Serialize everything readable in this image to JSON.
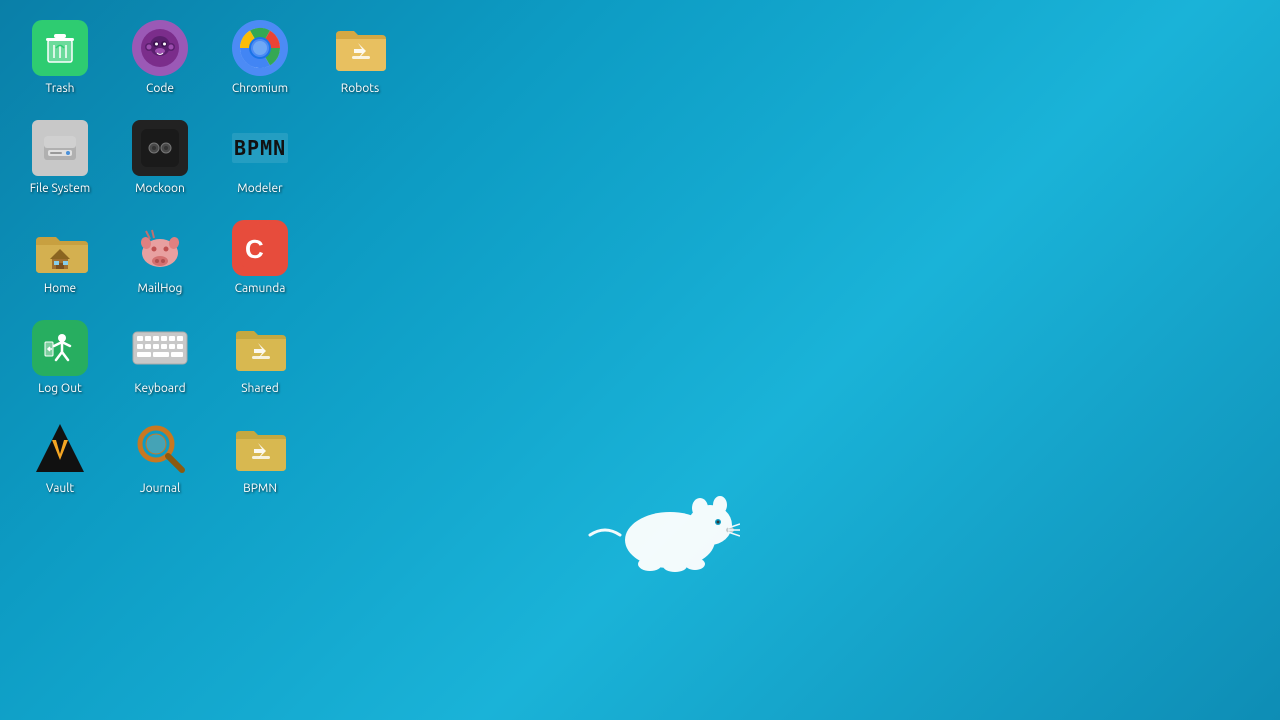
{
  "desktop": {
    "background": "teal-blue gradient",
    "mascot": "white mouse"
  },
  "icons": [
    {
      "id": "trash",
      "label": "Trash",
      "type": "trash",
      "row": 1,
      "col": 1
    },
    {
      "id": "code",
      "label": "Code",
      "type": "code",
      "row": 1,
      "col": 2
    },
    {
      "id": "chromium",
      "label": "Chromium",
      "type": "chromium",
      "row": 1,
      "col": 3
    },
    {
      "id": "robots",
      "label": "Robots",
      "type": "folder-shared",
      "row": 1,
      "col": 4
    },
    {
      "id": "filesystem",
      "label": "File System",
      "type": "filesystem",
      "row": 2,
      "col": 1
    },
    {
      "id": "mockoon",
      "label": "Mockoon",
      "type": "mockoon",
      "row": 2,
      "col": 2
    },
    {
      "id": "modeler",
      "label": "Modeler",
      "type": "modeler",
      "row": 2,
      "col": 3
    },
    {
      "id": "home",
      "label": "Home",
      "type": "home",
      "row": 3,
      "col": 1
    },
    {
      "id": "mailhog",
      "label": "MailHog",
      "type": "mailhog",
      "row": 3,
      "col": 2
    },
    {
      "id": "camunda",
      "label": "Camunda",
      "type": "camunda",
      "row": 3,
      "col": 3
    },
    {
      "id": "logout",
      "label": "Log Out",
      "type": "logout",
      "row": 4,
      "col": 1
    },
    {
      "id": "keyboard",
      "label": "Keyboard",
      "type": "keyboard",
      "row": 4,
      "col": 2
    },
    {
      "id": "shared",
      "label": "Shared",
      "type": "folder-shared",
      "row": 4,
      "col": 3
    },
    {
      "id": "vault",
      "label": "Vault",
      "type": "vault",
      "row": 5,
      "col": 1
    },
    {
      "id": "journal",
      "label": "Journal",
      "type": "journal",
      "row": 5,
      "col": 2
    },
    {
      "id": "bpmn",
      "label": "BPMN",
      "type": "folder-shared",
      "row": 5,
      "col": 3
    }
  ]
}
